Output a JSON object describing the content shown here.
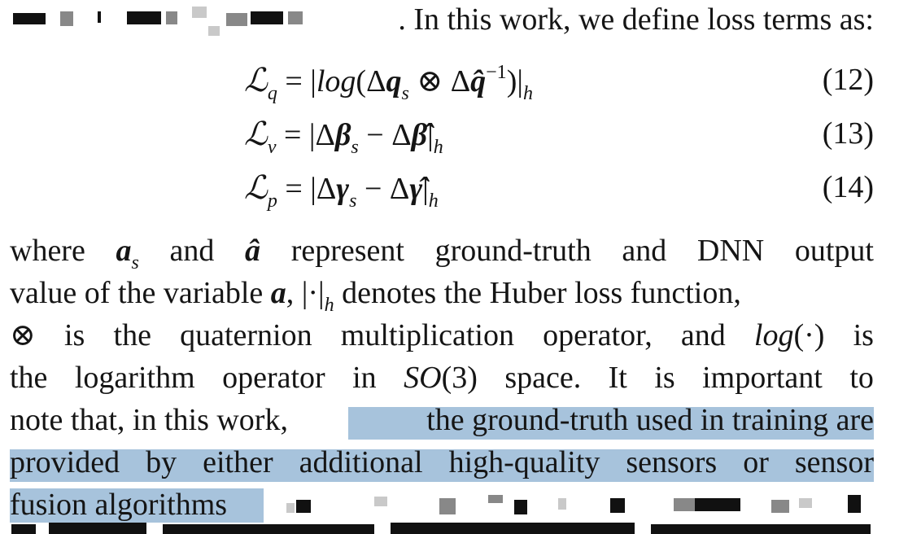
{
  "intro_fragment": ". In this work, we define loss terms as:",
  "equations": [
    {
      "number": "(12)",
      "lhs_sub": "q",
      "formula": "= |log(Δq_s ⊗ Δq̂^−1)|_h"
    },
    {
      "number": "(13)",
      "lhs_sub": "v",
      "formula": "= |Δβ_s − Δβ̂|_h"
    },
    {
      "number": "(14)",
      "lhs_sub": "p",
      "formula": "= |Δγ_s − Δγ̂|_h"
    }
  ],
  "paragraph": {
    "line1": [
      "where",
      "a_s",
      "and",
      "â",
      "represent",
      "ground-truth",
      "and",
      "DNN",
      "output"
    ],
    "line2": "value of the variable a, |·|_h denotes the Huber loss function,",
    "line3": [
      "⊗",
      "is",
      "the",
      "quaternion",
      "multiplication",
      "operator,",
      "and",
      "log(·)",
      "is"
    ],
    "line4": [
      "the",
      "logarithm",
      "operator",
      "in",
      "SO(3)",
      "space.",
      "It",
      "is",
      "important",
      "to"
    ],
    "line5_plain": "note that, in this work, ",
    "line5_highlight": "the ground-truth used in training are",
    "line6_highlight": "provided by either additional high-quality sensors or sensor",
    "line7_highlight": "fusion algorithms"
  },
  "highlight_color": "#a7c3dc"
}
